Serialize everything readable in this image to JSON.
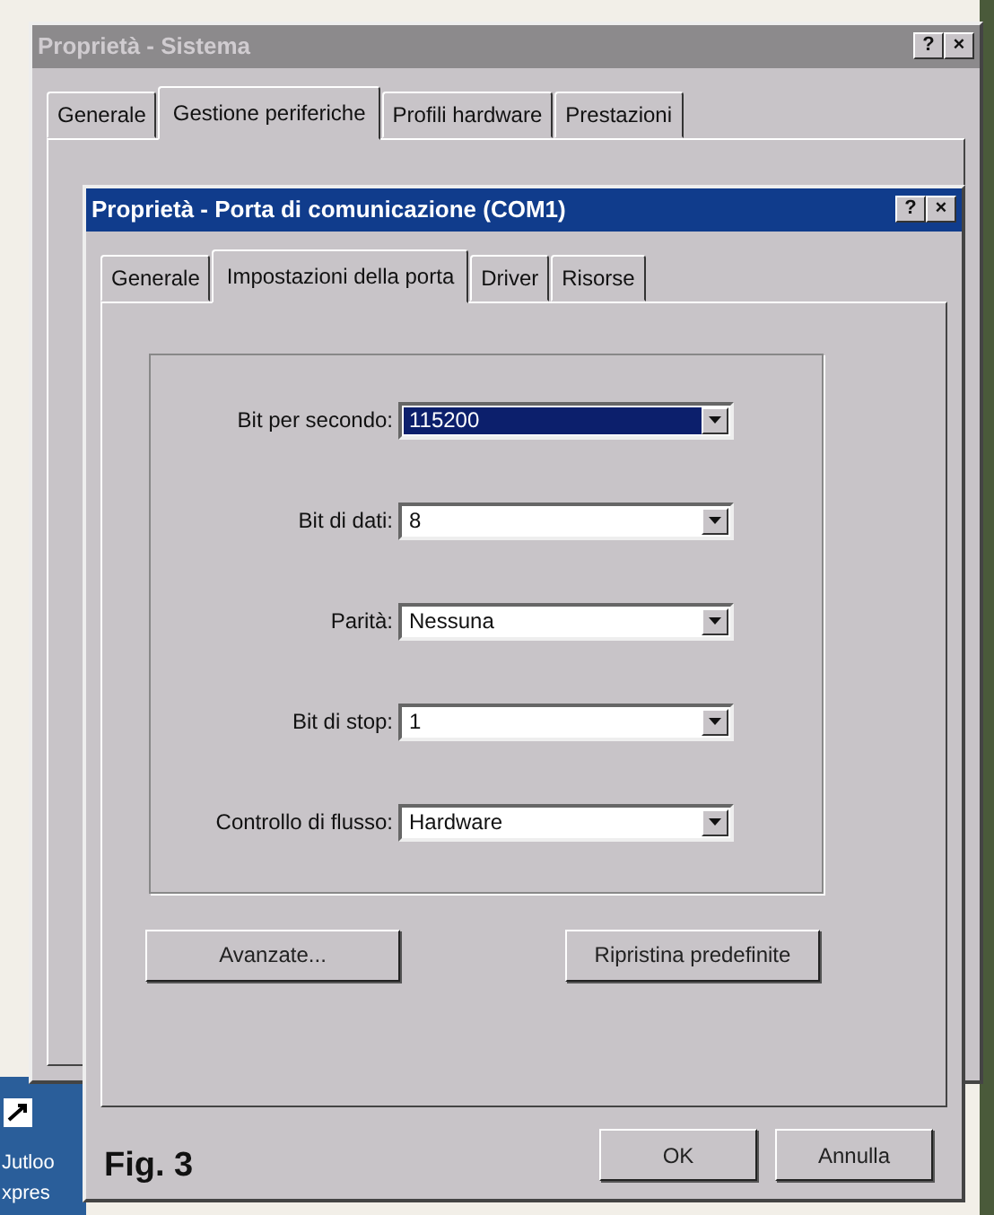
{
  "desktop_icon": {
    "label": "Jutloo\nxpres"
  },
  "outer_window": {
    "title": "Proprietà - Sistema",
    "active": false,
    "title_buttons": [
      "?",
      "×"
    ],
    "tabs": [
      {
        "label": "Generale",
        "selected": false
      },
      {
        "label": "Gestione periferiche",
        "selected": true
      },
      {
        "label": "Profili hardware",
        "selected": false
      },
      {
        "label": "Prestazioni",
        "selected": false
      }
    ]
  },
  "dialog": {
    "title": "Proprietà - Porta di comunicazione (COM1)",
    "active": true,
    "title_buttons": [
      "?",
      "×"
    ],
    "tabs": [
      {
        "label": "Generale",
        "selected": false
      },
      {
        "label": "Impostazioni della porta",
        "selected": true
      },
      {
        "label": "Driver",
        "selected": false
      },
      {
        "label": "Risorse",
        "selected": false
      }
    ],
    "fields": [
      {
        "label": "Bit per secondo:",
        "value": "115200",
        "focused": true
      },
      {
        "label": "Bit di dati:",
        "value": "8",
        "focused": false
      },
      {
        "label": "Parità:",
        "value": "Nessuna",
        "focused": false
      },
      {
        "label": "Bit di stop:",
        "value": "1",
        "focused": false
      },
      {
        "label": "Controllo di flusso:",
        "value": "Hardware",
        "focused": false
      }
    ],
    "panel_buttons": [
      "Avanzate...",
      "Ripristina predefinite"
    ],
    "buttons": [
      "OK",
      "Annulla"
    ]
  },
  "caption": "Fig. 3"
}
